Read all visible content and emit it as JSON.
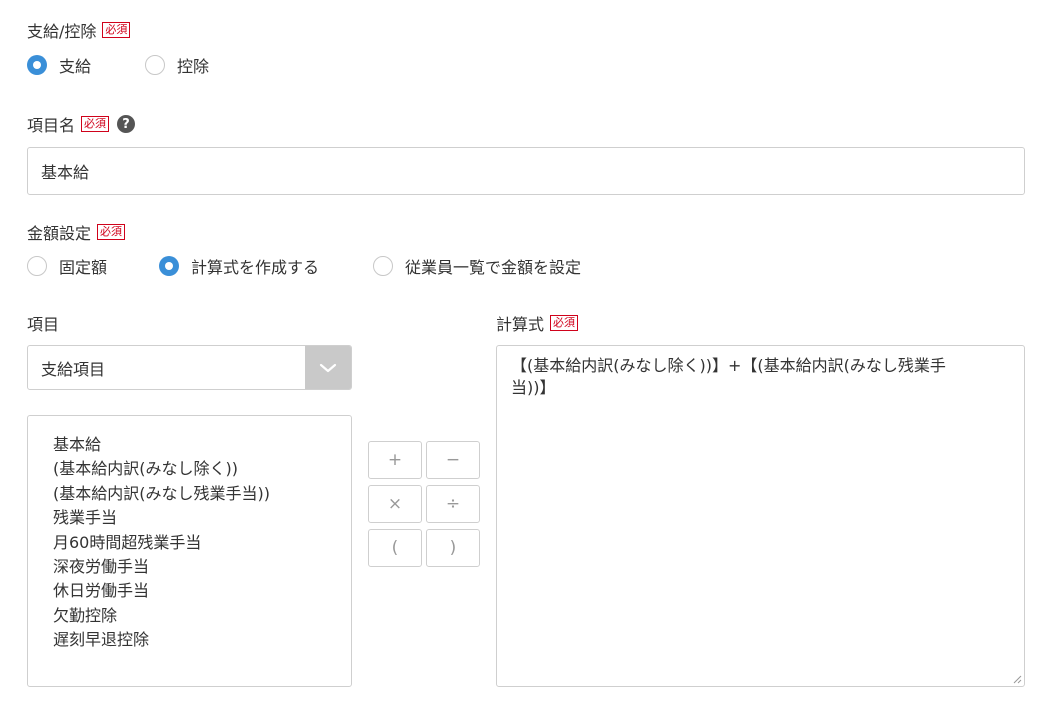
{
  "type_section": {
    "label": "支給/控除",
    "required": "必須",
    "options": [
      {
        "label": "支給",
        "checked": true
      },
      {
        "label": "控除",
        "checked": false
      }
    ]
  },
  "name_section": {
    "label": "項目名",
    "required": "必須",
    "help": "?",
    "value": "基本給"
  },
  "amount_section": {
    "label": "金額設定",
    "required": "必須",
    "options": [
      {
        "label": "固定額",
        "checked": false
      },
      {
        "label": "計算式を作成する",
        "checked": true
      },
      {
        "label": "従業員一覧で金額を設定",
        "checked": false
      }
    ]
  },
  "items_section": {
    "label": "項目",
    "select_value": "支給項目",
    "list": [
      "基本給",
      "(基本給内訳(みなし除く))",
      "(基本給内訳(みなし残業手当))",
      "残業手当",
      "月60時間超残業手当",
      "深夜労働手当",
      "休日労働手当",
      "欠勤控除",
      "遅刻早退控除"
    ]
  },
  "operators": {
    "plus": "+",
    "minus": "−",
    "times": "×",
    "divide": "÷",
    "lparen": "(",
    "rparen": ")"
  },
  "formula_section": {
    "label": "計算式",
    "required": "必須",
    "line1": "【(基本給内訳(みなし除く))】+【(基本給内訳(みなし残業手",
    "line2": "当))】"
  },
  "colors": {
    "accent": "#3a8fd8",
    "required": "#d0021b",
    "border": "#cfcfcf"
  }
}
